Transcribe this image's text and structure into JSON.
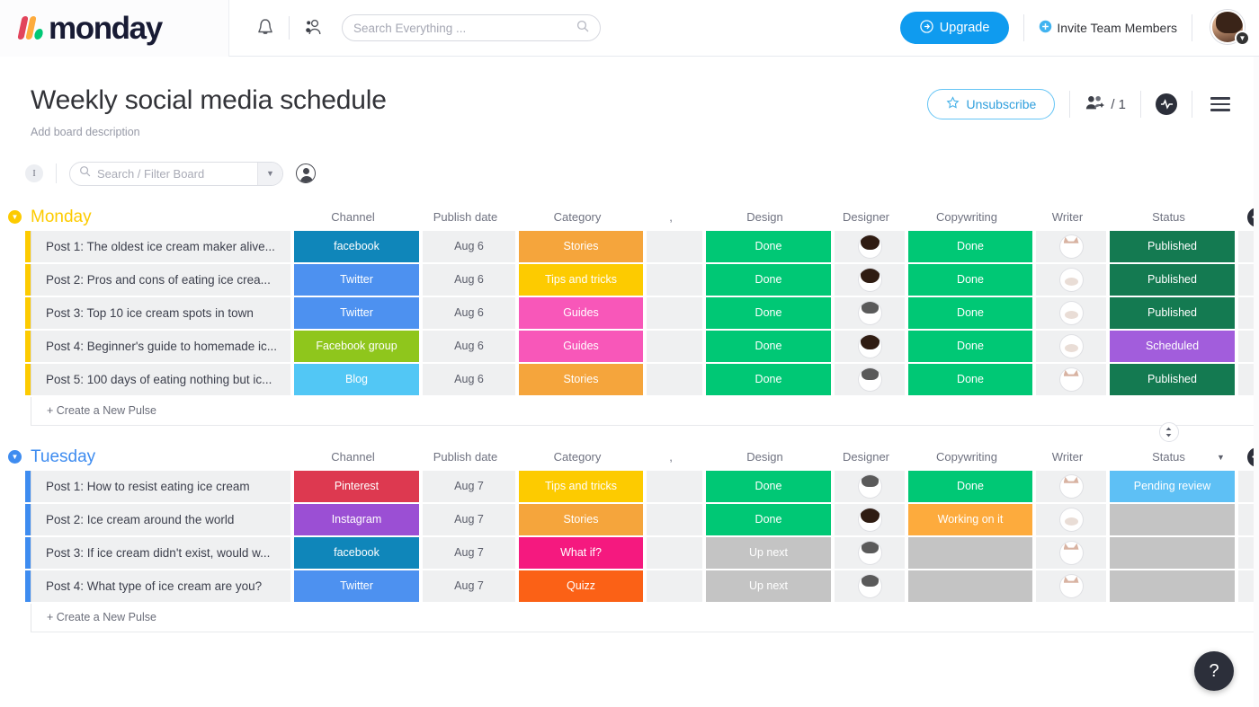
{
  "topnav": {
    "logo_text": "monday",
    "bell_icon": "notification-bell-icon",
    "people_icon": "team-people-icon",
    "search_placeholder": "Search Everything ...",
    "search_value": "",
    "search_icon": "search-icon",
    "upgrade_label": "Upgrade",
    "upgrade_icon": "upgrade-arrow-icon",
    "invite_label": "Invite Team Members",
    "invite_icon": "plus-circle-icon",
    "avatar_name": "user-avatar",
    "avatar_caret_icon": "chevron-down-icon",
    "accent_blue": "#0f9bef"
  },
  "board": {
    "title": "Weekly social media schedule",
    "description": "Add board description",
    "unsubscribe_label": "Unsubscribe",
    "unsubscribe_icon": "star-icon",
    "subscribers_icon": "add-people-icon",
    "subscribers_count": "/ 1",
    "activity_icon": "activity-pulse-icon",
    "menu_icon": "hamburger-menu-icon"
  },
  "filterbar": {
    "info_badge": "I",
    "search_placeholder": "Search / Filter Board",
    "search_value": "",
    "search_icon": "search-icon",
    "caret_icon": "chevron-down-icon",
    "person_icon": "person-filter-icon"
  },
  "columns": [
    "Channel",
    "Publish date",
    "Category",
    ",",
    "Design",
    "Designer",
    "Copywriting",
    "Writer",
    "Status"
  ],
  "add_column_icon": "plus-circle-icon",
  "new_pulse_label": "+ Create a New Pulse",
  "help_label": "?",
  "colors": {
    "facebook": "#0f86ba",
    "twitter": "#4d91f0",
    "facebook_group": "#8fc61c",
    "blog": "#52c7f5",
    "pinterest": "#dd3950",
    "instagram": "#9b4fd4",
    "stories": "#f5a53c",
    "tips_and_tricks": "#fdcb00",
    "guides": "#f857b9",
    "what_if": "#f5197f",
    "quizz": "#fb6116",
    "done": "#00c875",
    "working_on_it": "#fdab3d",
    "up_next": "#c4c4c4",
    "published": "#147a51",
    "scheduled": "#a25ddc",
    "pending_review": "#5ec0f5",
    "empty": "#c4c4c4",
    "monday_group": "#fdcb00",
    "tuesday_group": "#3e8cf0"
  },
  "groups": [
    {
      "name": "Monday",
      "color": "#fdcb00",
      "bar_color": "#fdcb00",
      "caret_icon": "chevron-down-circle-icon",
      "sorted": false,
      "rows": [
        {
          "name": "Post 1: The oldest ice cream maker alive...",
          "channel": "facebook",
          "channel_color": "#0f86ba",
          "date": "Aug 6",
          "category": "Stories",
          "category_color": "#f5a53c",
          "design": "Done",
          "design_color": "#00c875",
          "designer": "p-woman",
          "copywriting": "Done",
          "copywriting_color": "#00c875",
          "writer": "p-cat",
          "status": "Published",
          "status_color": "#147a51"
        },
        {
          "name": "Post 2: Pros and cons of eating ice crea...",
          "channel": "Twitter",
          "channel_color": "#4d91f0",
          "date": "Aug 6",
          "category": "Tips and tricks",
          "category_color": "#fdcb00",
          "design": "Done",
          "design_color": "#00c875",
          "designer": "p-woman",
          "copywriting": "Done",
          "copywriting_color": "#00c875",
          "writer": "p-cat2",
          "status": "Published",
          "status_color": "#147a51"
        },
        {
          "name": "Post 3: Top 10 ice cream spots in town",
          "channel": "Twitter",
          "channel_color": "#4d91f0",
          "date": "Aug 6",
          "category": "Guides",
          "category_color": "#f857b9",
          "design": "Done",
          "design_color": "#00c875",
          "designer": "p-man",
          "copywriting": "Done",
          "copywriting_color": "#00c875",
          "writer": "p-cat2",
          "status": "Published",
          "status_color": "#147a51"
        },
        {
          "name": "Post 4: Beginner's guide to homemade ic...",
          "channel": "Facebook group",
          "channel_color": "#8fc61c",
          "date": "Aug 6",
          "category": "Guides",
          "category_color": "#f857b9",
          "design": "Done",
          "design_color": "#00c875",
          "designer": "p-woman",
          "copywriting": "Done",
          "copywriting_color": "#00c875",
          "writer": "p-cat2",
          "status": "Scheduled",
          "status_color": "#a25ddc"
        },
        {
          "name": "Post 5: 100 days of eating nothing but ic...",
          "channel": "Blog",
          "channel_color": "#52c7f5",
          "date": "Aug 6",
          "category": "Stories",
          "category_color": "#f5a53c",
          "design": "Done",
          "design_color": "#00c875",
          "designer": "p-man",
          "copywriting": "Done",
          "copywriting_color": "#00c875",
          "writer": "p-cat",
          "status": "Published",
          "status_color": "#147a51"
        }
      ]
    },
    {
      "name": "Tuesday",
      "color": "#3e8cf0",
      "bar_color": "#3e8cf0",
      "caret_icon": "chevron-down-circle-icon",
      "sorted": true,
      "sort_icon": "sort-updown-icon",
      "dropdown_icon": "chevron-down-icon",
      "rows": [
        {
          "name": "Post 1: How to resist eating ice cream",
          "channel": "Pinterest",
          "channel_color": "#dd3950",
          "date": "Aug 7",
          "category": "Tips and tricks",
          "category_color": "#fdcb00",
          "design": "Done",
          "design_color": "#00c875",
          "designer": "p-man",
          "copywriting": "Done",
          "copywriting_color": "#00c875",
          "writer": "p-cat",
          "status": "Pending review",
          "status_color": "#5ec0f5"
        },
        {
          "name": "Post 2: Ice cream around the world",
          "channel": "Instagram",
          "channel_color": "#9b4fd4",
          "date": "Aug 7",
          "category": "Stories",
          "category_color": "#f5a53c",
          "design": "Done",
          "design_color": "#00c875",
          "designer": "p-woman",
          "copywriting": "Working on it",
          "copywriting_color": "#fdab3d",
          "writer": "p-cat2",
          "status": "",
          "status_color": "#c4c4c4"
        },
        {
          "name": "Post 3: If ice cream didn't exist, would w...",
          "channel": "facebook",
          "channel_color": "#0f86ba",
          "date": "Aug 7",
          "category": "What if?",
          "category_color": "#f5197f",
          "design": "Up next",
          "design_color": "#c4c4c4",
          "designer": "p-man",
          "copywriting": "",
          "copywriting_color": "#c4c4c4",
          "writer": "p-cat",
          "status": "",
          "status_color": "#c4c4c4"
        },
        {
          "name": "Post 4: What type of ice cream are you?",
          "channel": "Twitter",
          "channel_color": "#4d91f0",
          "date": "Aug 7",
          "category": "Quizz",
          "category_color": "#fb6116",
          "design": "Up next",
          "design_color": "#c4c4c4",
          "designer": "p-man",
          "copywriting": "",
          "copywriting_color": "#c4c4c4",
          "writer": "p-cat",
          "status": "",
          "status_color": "#c4c4c4"
        }
      ]
    }
  ]
}
